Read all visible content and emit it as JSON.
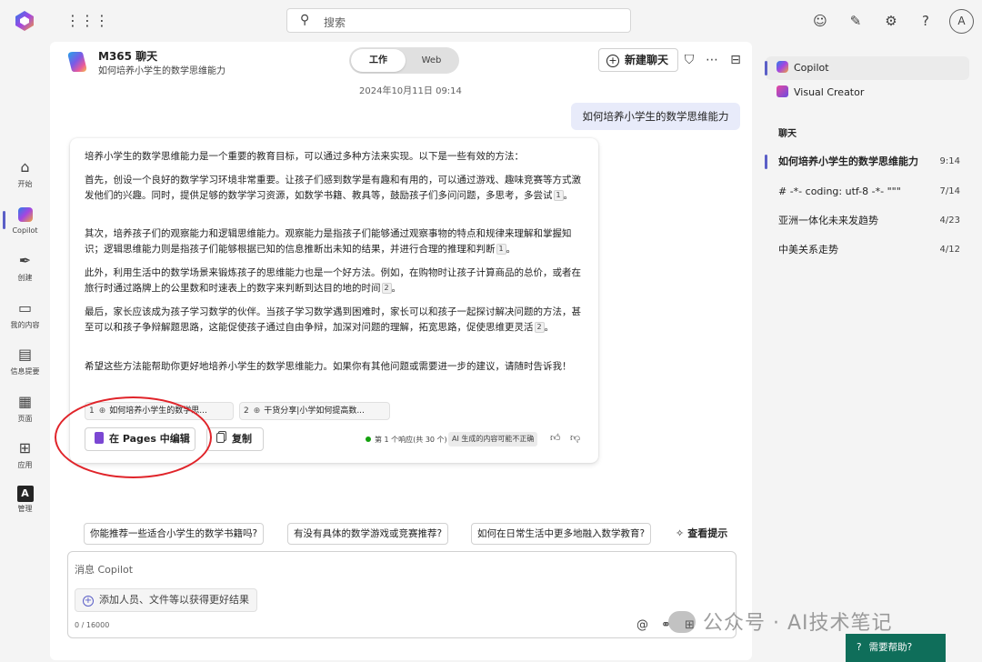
{
  "topbar": {
    "search_placeholder": "搜索",
    "avatar_initial": "A"
  },
  "rail": {
    "items": [
      {
        "label": "开始",
        "icon": "home-icon"
      },
      {
        "label": "Copilot",
        "icon": "copilot-icon"
      },
      {
        "label": "创建",
        "icon": "pen-icon"
      },
      {
        "label": "我的内容",
        "icon": "folder-icon"
      },
      {
        "label": "信息提要",
        "icon": "feed-icon"
      },
      {
        "label": "页面",
        "icon": "pages-icon"
      },
      {
        "label": "应用",
        "icon": "apps-icon"
      },
      {
        "label": "管理",
        "icon": "admin-icon"
      }
    ]
  },
  "chat": {
    "title": "M365 聊天",
    "subtitle": "如何培养小学生的数学思维能力",
    "toggle_work": "工作",
    "toggle_web": "Web",
    "new_chat": "新建聊天",
    "date": "2024年10月11日 09:14",
    "user_message": "如何培养小学生的数学思维能力",
    "answer": {
      "p1": "培养小学生的数学思维能力是一个重要的教育目标，可以通过多种方法来实现。以下是一些有效的方法：",
      "p2": "首先，创设一个良好的数学学习环境非常重要。让孩子们感到数学是有趣和有用的，可以通过游戏、趣味竞赛等方式激发他们的兴趣。同时，提供足够的数学学习资源，如数学书籍、教具等，鼓励孩子们多问问题，多思考，多尝试",
      "p3": "其次，培养孩子们的观察能力和逻辑思维能力。观察能力是指孩子们能够通过观察事物的特点和规律来理解和掌握知识；逻辑思维能力则是指孩子们能够根据已知的信息推断出未知的结果，并进行合理的推理和判断",
      "p4": "此外，利用生活中的数学场景来锻炼孩子的思维能力也是一个好方法。例如，在购物时让孩子计算商品的总价，或者在旅行时通过路牌上的公里数和时速表上的数字来判断到达目的地的时间",
      "p5": "最后，家长应该成为孩子学习数学的伙伴。当孩子学习数学遇到困难时，家长可以和孩子一起探讨解决问题的方法，甚至可以和孩子争辩解题思路，这能促使孩子通过自由争辩，加深对问题的理解，拓宽思路，促使思维更灵活",
      "p6": "希望这些方法能帮助你更好地培养小学生的数学思维能力。如果你有其他问题或需要进一步的建议，请随时告诉我！",
      "cite1": "1",
      "cite2": "2",
      "period": "。",
      "refs": [
        {
          "num": "1",
          "title": "如何培养小学生的数学思..."
        },
        {
          "num": "2",
          "title": "干货分享|小学如何提高数..."
        }
      ],
      "edit_in_pages": "在 Pages 中编辑",
      "copy": "复制",
      "response_meta": "第 1 个响应(共 30 个)",
      "ai_disclaimer": "AI 生成的内容可能不正确"
    },
    "suggestions": [
      "你能推荐一些适合小学生的数学书籍吗?",
      "有没有具体的数学游戏或竞赛推荐?",
      "如何在日常生活中更多地融入数学教育?"
    ],
    "view_prompts": "查看提示",
    "composer_placeholder": "消息 Copilot",
    "add_people": "添加人员、文件等以获得更好结果",
    "char_count": "0 / 16000"
  },
  "right_panel": {
    "copilot": "Copilot",
    "visual_creator": "Visual Creator",
    "chats_heading": "聊天",
    "history": [
      {
        "title": "如何培养小学生的数学思维能力",
        "time": "9:14"
      },
      {
        "title": "# -*- coding: utf-8 -*- \"\"\"",
        "time": "7/14"
      },
      {
        "title": "亚洲一体化未来发趋势",
        "time": "4/23"
      },
      {
        "title": "中美关系走势",
        "time": "4/12"
      }
    ]
  },
  "help_button": "需要帮助?",
  "watermark": "公众号 · AI技术笔记"
}
